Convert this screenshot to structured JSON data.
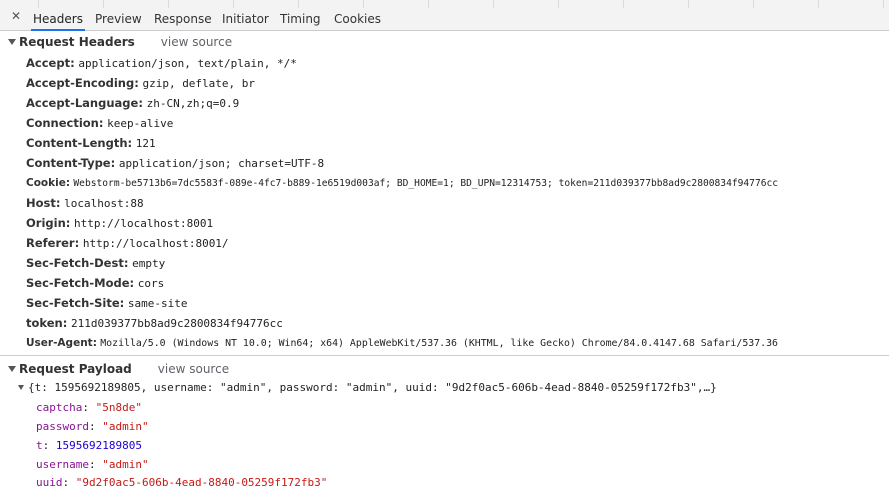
{
  "tabs": {
    "close_glyph": "✕",
    "items": [
      {
        "label": "Headers"
      },
      {
        "label": "Preview"
      },
      {
        "label": "Response"
      },
      {
        "label": "Initiator"
      },
      {
        "label": "Timing"
      },
      {
        "label": "Cookies"
      }
    ],
    "active_index": 0,
    "accent": "#1a73e8"
  },
  "request_headers": {
    "title": "Request Headers",
    "view_source": "view source",
    "items": [
      {
        "name": "Accept:",
        "value": "application/json, text/plain, */*"
      },
      {
        "name": "Accept-Encoding:",
        "value": "gzip, deflate, br"
      },
      {
        "name": "Accept-Language:",
        "value": "zh-CN,zh;q=0.9"
      },
      {
        "name": "Connection:",
        "value": "keep-alive"
      },
      {
        "name": "Content-Length:",
        "value": "121"
      },
      {
        "name": "Content-Type:",
        "value": "application/json; charset=UTF-8"
      },
      {
        "name": "Cookie:",
        "value": "Webstorm-be5713b6=7dc5583f-089e-4fc7-b889-1e6519d003af; BD_HOME=1; BD_UPN=12314753; token=211d039377bb8ad9c2800834f94776cc"
      },
      {
        "name": "Host:",
        "value": "localhost:88"
      },
      {
        "name": "Origin:",
        "value": "http://localhost:8001"
      },
      {
        "name": "Referer:",
        "value": "http://localhost:8001/"
      },
      {
        "name": "Sec-Fetch-Dest:",
        "value": "empty"
      },
      {
        "name": "Sec-Fetch-Mode:",
        "value": "cors"
      },
      {
        "name": "Sec-Fetch-Site:",
        "value": "same-site"
      },
      {
        "name": "token:",
        "value": "211d039377bb8ad9c2800834f94776cc"
      },
      {
        "name": "User-Agent:",
        "value": "Mozilla/5.0 (Windows NT 10.0; Win64; x64) AppleWebKit/537.36 (KHTML, like Gecko) Chrome/84.0.4147.68 Safari/537.36"
      }
    ]
  },
  "request_payload": {
    "title": "Request Payload",
    "view_source": "view source",
    "summary": "{t: 1595692189805, username: \"admin\", password: \"admin\", uuid: \"9d2f0ac5-606b-4ead-8840-05259f172fb3\",…}",
    "properties": [
      {
        "key": "captcha",
        "sep": ": ",
        "value": "\"5n8de\"",
        "kind": "string"
      },
      {
        "key": "password",
        "sep": ": ",
        "value": "\"admin\"",
        "kind": "string"
      },
      {
        "key": "t",
        "sep": ": ",
        "value": "1595692189805",
        "kind": "number"
      },
      {
        "key": "username",
        "sep": ": ",
        "value": "\"admin\"",
        "kind": "string"
      },
      {
        "key": "uuid",
        "sep": ": ",
        "value": "\"9d2f0ac5-606b-4ead-8840-05259f172fb3\"",
        "kind": "string"
      }
    ]
  }
}
